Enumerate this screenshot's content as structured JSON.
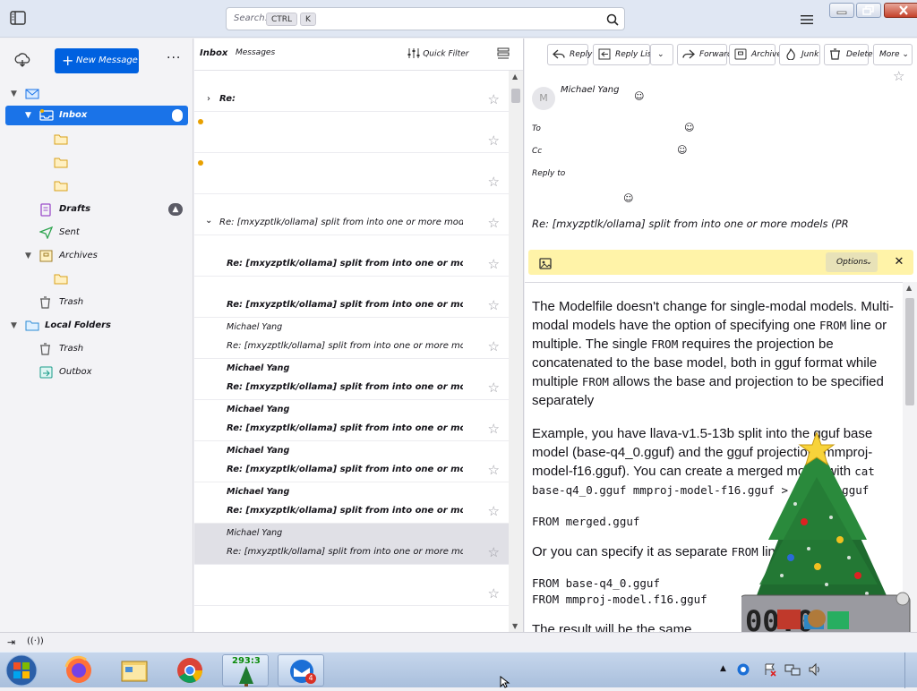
{
  "search": {
    "placeholder": "Search…",
    "key1": "CTRL",
    "key2": "K"
  },
  "folder_pane": {
    "new_message": "New Message",
    "account": "",
    "folders": [
      {
        "label": "Inbox",
        "badge": ""
      },
      {
        "label": ""
      },
      {
        "label": ""
      },
      {
        "label": ""
      },
      {
        "label": "Drafts"
      },
      {
        "label": "Sent"
      },
      {
        "label": "Archives"
      },
      {
        "label": ""
      },
      {
        "label": "Trash"
      },
      {
        "label": "Local Folders"
      },
      {
        "label": "Trash"
      },
      {
        "label": "Outbox"
      }
    ]
  },
  "thread_pane": {
    "title": "Inbox",
    "count": "Messages",
    "quick_filter": "Quick Filter",
    "messages": [
      {
        "from": "",
        "subject": "Re: ",
        "date": ""
      },
      {
        "from": "",
        "subject": "",
        "date": ""
      },
      {
        "from": "",
        "subject": "",
        "date": ""
      },
      {
        "from": "",
        "subject": "Re: [mxyzptlk/ollama] split from into one or more models (PR",
        "date": ""
      },
      {
        "from": "",
        "subject": "Re: [mxyzptlk/ollama] split from into one or more models (PR",
        "date": ""
      },
      {
        "from": "",
        "subject": "Re: [mxyzptlk/ollama] split from into one or more models (PR",
        "date": ""
      },
      {
        "from": "Michael Yang",
        "subject": "Re: [mxyzptlk/ollama] split from into one or more models (PR",
        "date": ""
      },
      {
        "from": "Michael Yang",
        "subject": "Re: [mxyzptlk/ollama] split from into one or more models (PR",
        "date": ""
      },
      {
        "from": "Michael Yang",
        "subject": "Re: [mxyzptlk/ollama] split from into one or more models (PR",
        "date": ""
      },
      {
        "from": "Michael Yang",
        "subject": "Re: [mxyzptlk/ollama] split from into one or more models (PR",
        "date": ""
      },
      {
        "from": "Michael Yang",
        "subject": "Re: [mxyzptlk/ollama] split from into one or more models (PR",
        "date": ""
      },
      {
        "from": "Michael Yang",
        "subject": "Re: [mxyzptlk/ollama] split from into one or more models (PR",
        "date": ""
      },
      {
        "from": "",
        "subject": "",
        "date": ""
      }
    ]
  },
  "message_pane": {
    "toolbar": [
      "Reply",
      "Reply List",
      "Forward",
      "Archive",
      "Junk",
      "Delete",
      "More"
    ],
    "sender_name": "Michael Yang",
    "sender_email": "",
    "to_label": "To",
    "to_value": "",
    "cc_label": "Cc",
    "cc_value": "",
    "reply_label": "Reply to",
    "reply_value_1": "",
    "reply_value_2": "",
    "reply_value_3": "",
    "date": "",
    "subject": "Re: [mxyzptlk/ollama] split from into one or more models (PR",
    "notice": "",
    "notice_options": "Options",
    "body": {
      "p1_a": "The Modelfile doesn't change for single-modal models. Multi-modal models have the option of specifying one ",
      "p1_code1": "FROM",
      "p1_b": " line or multiple. The single ",
      "p1_code2": "FROM",
      "p1_c": " requires the projection be concatenated to the base model, both in gguf format while multiple ",
      "p1_code3": "FROM",
      "p1_d": " allows the base and projection to be specified separately",
      "p2_a": "Example, you have llava-v1.5-13b split into the gguf base model (base-q4_0.gguf) and the gguf projection (mmproj-model-f16.gguf). You can create a merged model with ",
      "p2_code": "cat base-q4_0.gguf mmproj-model-f16.gguf > merged.gguf",
      "code1": "FROM merged.gguf",
      "p3_a": "Or you can specify it as separate ",
      "p3_code": "FROM",
      "p3_b": " lines",
      "code2": "FROM base-q4_0.gguf\nFROM mmproj-model.f16.gguf",
      "p4": "The result will be the same"
    }
  },
  "status_bar": {
    "text": " "
  },
  "taskbar": {
    "counter": "293:3",
    "mail_badge": "4",
    "clock_time": "",
    "clock_date": ""
  },
  "colors": {
    "accent": "#0061e0",
    "selection": "#1a73e8",
    "notice": "#fff3a8",
    "taskbar": "#b4c8e2"
  }
}
